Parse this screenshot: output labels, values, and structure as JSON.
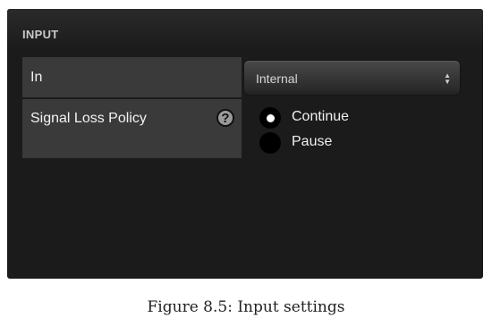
{
  "panel": {
    "title": "INPUT",
    "rows": {
      "in_label": "In",
      "policy_label": "Signal Loss Policy"
    },
    "help_icon": "question-circle-icon",
    "select": {
      "value": "Internal",
      "icon": "up-down-arrows-icon"
    },
    "policy_options": [
      {
        "label": "Continue",
        "selected": true
      },
      {
        "label": "Pause",
        "selected": false
      }
    ]
  },
  "caption": "Figure 8.5: Input settings"
}
